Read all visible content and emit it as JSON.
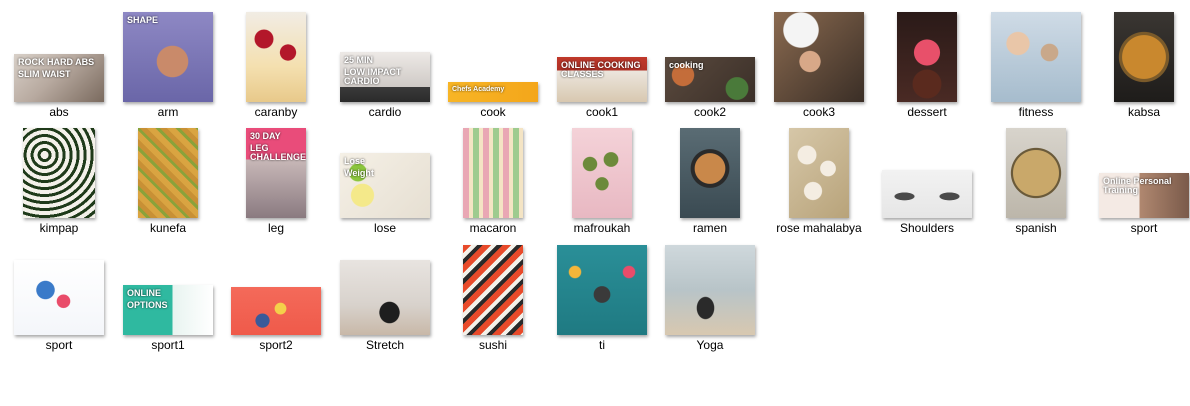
{
  "items": [
    {
      "name": "abs",
      "col": 0,
      "row": 0,
      "w": 90,
      "h": 48,
      "bg": "linear-gradient(135deg,#d8d0c8 0%,#b8aaa0 45%,#7a6a5e 100%)",
      "texts": [
        "ROCK HARD ABS",
        "SLIM WAIST"
      ]
    },
    {
      "name": "arm",
      "col": 1,
      "row": 0,
      "w": 90,
      "h": 90,
      "bg": "radial-gradient(circle at 55% 55%,#c98a6a 0 22%,transparent 23%),linear-gradient(180deg,#8e88c4 0%,#6a66a8 100%)",
      "texts": [
        "SHAPE"
      ]
    },
    {
      "name": "caranby",
      "col": 2,
      "row": 0,
      "w": 60,
      "h": 90,
      "bg": "radial-gradient(circle at 30% 30%,#b3172a 0 12%,transparent 13%),radial-gradient(circle at 70% 45%,#b3172a 0 12%,transparent 13%),linear-gradient(180deg,#f1ece4 0%,#f4e0b0 60%,#e8c98a 100%)",
      "texts": []
    },
    {
      "name": "cardio",
      "col": 3,
      "row": 0,
      "w": 90,
      "h": 50,
      "bg": "linear-gradient(180deg,#ede9e6 0%,#cfcac6 70%,#3a3a3a 70%,#2a2a2a 100%)",
      "texts": [
        "25 MIN",
        "LOW IMPACT CARDIO"
      ]
    },
    {
      "name": "cook",
      "col": 4,
      "row": 0,
      "w": 90,
      "h": 20,
      "bg": "linear-gradient(90deg,#f7b526 0%,#f4a61a 100%)",
      "texts": [
        "Chefs Academy"
      ]
    },
    {
      "name": "cook1",
      "col": 5,
      "row": 0,
      "w": 90,
      "h": 45,
      "bg": "linear-gradient(180deg,#c0392b 0%,#b03025 30%,#ece6de 30%,#d8c8b0 100%)",
      "texts": [
        "ONLINE COOKING CLASSES"
      ]
    },
    {
      "name": "cook2",
      "col": 6,
      "row": 0,
      "w": 90,
      "h": 45,
      "bg": "radial-gradient(circle at 20% 40%,#c46d3a 0 14%,transparent 15%),radial-gradient(circle at 80% 70%,#4a7a3a 0 14%,transparent 15%),linear-gradient(135deg,#5b4a3e 0%,#3a2f28 100%)",
      "texts": [
        "cooking"
      ]
    },
    {
      "name": "cook3",
      "col": 7,
      "row": 0,
      "w": 90,
      "h": 90,
      "bg": "radial-gradient(circle at 30% 20%,#f4f4f4 0 18%,transparent 19%),radial-gradient(circle at 40% 55%,#d8a888 0 14%,transparent 15%),linear-gradient(135deg,#8a6a50 0%,#3a2e26 100%)",
      "texts": []
    },
    {
      "name": "dessert",
      "col": 8,
      "row": 0,
      "w": 60,
      "h": 90,
      "bg": "radial-gradient(circle at 50% 45%,#e8506a 0 22%,transparent 23%),radial-gradient(circle at 50% 80%,#5a2a1e 0 18%,transparent 19%),linear-gradient(180deg,#2a1a18 0%,#4a2a24 100%)",
      "texts": []
    },
    {
      "name": "fitness",
      "col": 9,
      "row": 0,
      "w": 90,
      "h": 90,
      "bg": "radial-gradient(circle at 30% 35%,#e9c6a8 0 13%,transparent 14%),radial-gradient(circle at 65% 45%,#c9a88a 0 11%,transparent 12%),linear-gradient(180deg,#cfdbe6 0%,#a6bccd 100%)",
      "texts": []
    },
    {
      "name": "kabsa",
      "col": 10,
      "row": 0,
      "w": 60,
      "h": 90,
      "bg": "radial-gradient(circle at 50% 50%,#c9882e 0 40%,#7a5a2a 41% 46%,transparent 47%),linear-gradient(180deg,#3a3632 0%,#1e1c1a 100%)",
      "texts": []
    },
    {
      "name": "kimpap",
      "col": 0,
      "row": 1,
      "w": 72,
      "h": 90,
      "bg": "repeating-radial-gradient(circle at 30% 30%,#f4f1ea 0 4px,#1f3a1a 4px 7px),linear-gradient(180deg,#2a2a2a,#1a1a1a)",
      "texts": []
    },
    {
      "name": "kunefa",
      "col": 1,
      "row": 1,
      "w": 60,
      "h": 90,
      "bg": "repeating-linear-gradient(45deg,#d9a441 0 6px,#8aa23a 6px 9px,#c89035 9px 14px),#c9962e",
      "texts": []
    },
    {
      "name": "leg",
      "col": 2,
      "row": 1,
      "w": 60,
      "h": 90,
      "bg": "linear-gradient(180deg,#e94c7a 0%,#e94c7a 35%,#c8b8b8 35%,#8a7a80 100%)",
      "texts": [
        "30 DAY",
        "LEG CHALLENGE"
      ]
    },
    {
      "name": "lose",
      "col": 3,
      "row": 1,
      "w": 90,
      "h": 65,
      "bg": "radial-gradient(circle at 20% 30%,#8cc63f 0 10%,transparent 11%),radial-gradient(circle at 25% 65%,#f4e98a 0 14%,transparent 15%),linear-gradient(135deg,#f5f0e6 0%,#e6dfd2 100%)",
      "texts": [
        "Lose",
        "Weight"
      ]
    },
    {
      "name": "macaron",
      "col": 4,
      "row": 1,
      "w": 60,
      "h": 90,
      "bg": "repeating-linear-gradient(90deg,#e9a7b4 0 6px,#f4e4c4 6px 10px,#9ecb8f 10px 16px,#f4e4c4 16px 20px),#efe6da",
      "texts": []
    },
    {
      "name": "mafroukah",
      "col": 5,
      "row": 1,
      "w": 60,
      "h": 90,
      "bg": "radial-gradient(circle at 30% 40%,#6c8a3a 0 10%,transparent 11%),radial-gradient(circle at 65% 35%,#6c8a3a 0 10%,transparent 11%),radial-gradient(circle at 50% 62%,#6c8a3a 0 10%,transparent 11%),linear-gradient(180deg,#f4d2d8 0%,#e8b8c2 100%)",
      "texts": []
    },
    {
      "name": "ramen",
      "col": 6,
      "row": 1,
      "w": 60,
      "h": 90,
      "bg": "radial-gradient(circle at 50% 45%,#c9884a 0 26%,#2a2a2a 27% 33%,transparent 34%),linear-gradient(180deg,#5a6c74 0%,#3a4a52 100%)",
      "texts": []
    },
    {
      "name": "rose mahalabya",
      "col": 7,
      "row": 1,
      "w": 60,
      "h": 90,
      "bg": "radial-gradient(circle at 30% 30%,#f4ede2 0 12%,transparent 13%),radial-gradient(circle at 65% 45%,#f4ede2 0 12%,transparent 13%),radial-gradient(circle at 40% 70%,#f4ede2 0 12%,transparent 13%),linear-gradient(135deg,#d6c7a8 0%,#b8a37a 100%)",
      "texts": []
    },
    {
      "name": "Shoulders",
      "col": 8,
      "row": 1,
      "w": 90,
      "h": 48,
      "bg": "radial-gradient(ellipse at 25% 55%,#4a4a4a 0 10%,transparent 11%),radial-gradient(ellipse at 75% 55%,#4a4a4a 0 10%,transparent 11%),linear-gradient(180deg,#f2f2f2 0%,#e6e6e6 100%)",
      "texts": []
    },
    {
      "name": "spanish",
      "col": 9,
      "row": 1,
      "w": 60,
      "h": 90,
      "bg": "radial-gradient(circle at 50% 50%,#c9a86a 0 42%,#6a5a3a 43% 46%,transparent 47%),linear-gradient(180deg,#d8d4cc,#bcb6aa)",
      "texts": []
    },
    {
      "name": "sport",
      "col": 10,
      "row": 1,
      "w": 90,
      "h": 45,
      "bg": "linear-gradient(90deg,#f4eae4 0%,#f4eae4 45%,#b08870 45%,#7a5a4a 100%)",
      "texts": [
        "Online Personal Training"
      ]
    },
    {
      "name": "sport",
      "col": 0,
      "row": 2,
      "w": 90,
      "h": 75,
      "bg": "radial-gradient(circle at 55% 55%,#e94c6a 0 10%,transparent 11%),radial-gradient(circle at 35% 40%,#3a7ac9 0 12%,transparent 13%),linear-gradient(180deg,#ffffff 0%,#f4f6fa 100%)",
      "texts": []
    },
    {
      "name": "sport1",
      "col": 1,
      "row": 2,
      "w": 90,
      "h": 50,
      "bg": "linear-gradient(90deg,#2fb9a0 0%,#2fb9a0 55%,#e8f4f0 55%,#ffffff 100%)",
      "texts": [
        "ONLINE",
        "OPTIONS"
      ]
    },
    {
      "name": "sport2",
      "col": 2,
      "row": 2,
      "w": 90,
      "h": 48,
      "bg": "radial-gradient(circle at 55% 45%,#f4d04a 0 10%,transparent 11%),radial-gradient(circle at 35% 70%,#3a5a9a 0 10%,transparent 11%),linear-gradient(180deg,#f46a5a 0%,#ef5a4a 100%)",
      "texts": []
    },
    {
      "name": "Stretch",
      "col": 3,
      "row": 2,
      "w": 90,
      "h": 75,
      "bg": "radial-gradient(ellipse at 55% 70%,#1e1e1e 0 14%,transparent 15%),linear-gradient(180deg,#e8e4e0 0%,#d8d2cc 60%,#c8b8a8 100%)",
      "texts": []
    },
    {
      "name": "sushi",
      "col": 4,
      "row": 2,
      "w": 60,
      "h": 90,
      "bg": "repeating-linear-gradient(135deg,#e84a2a 0 6px,#f4f1ea 6px 10px,#2a2a2a 10px 14px),#1e1e1e",
      "texts": []
    },
    {
      "name": "ti",
      "col": 5,
      "row": 2,
      "w": 90,
      "h": 90,
      "bg": "radial-gradient(circle at 50% 55%,#3a3a3a 0 12%,transparent 13%),radial-gradient(circle at 20% 30%,#f4b63a 0 6%,transparent 7%),radial-gradient(circle at 80% 30%,#e94c6a 0 6%,transparent 7%),linear-gradient(180deg,#2a8f98 0%,#1f7a82 100%)",
      "texts": []
    },
    {
      "name": "Yoga",
      "col": 6,
      "row": 2,
      "w": 90,
      "h": 90,
      "bg": "radial-gradient(ellipse at 45% 70%,#2a2a2a 0 12%,transparent 13%),linear-gradient(180deg,#cfd8dc 0%,#b8c4c8 50%,#d8c8b0 100%)",
      "texts": []
    }
  ]
}
